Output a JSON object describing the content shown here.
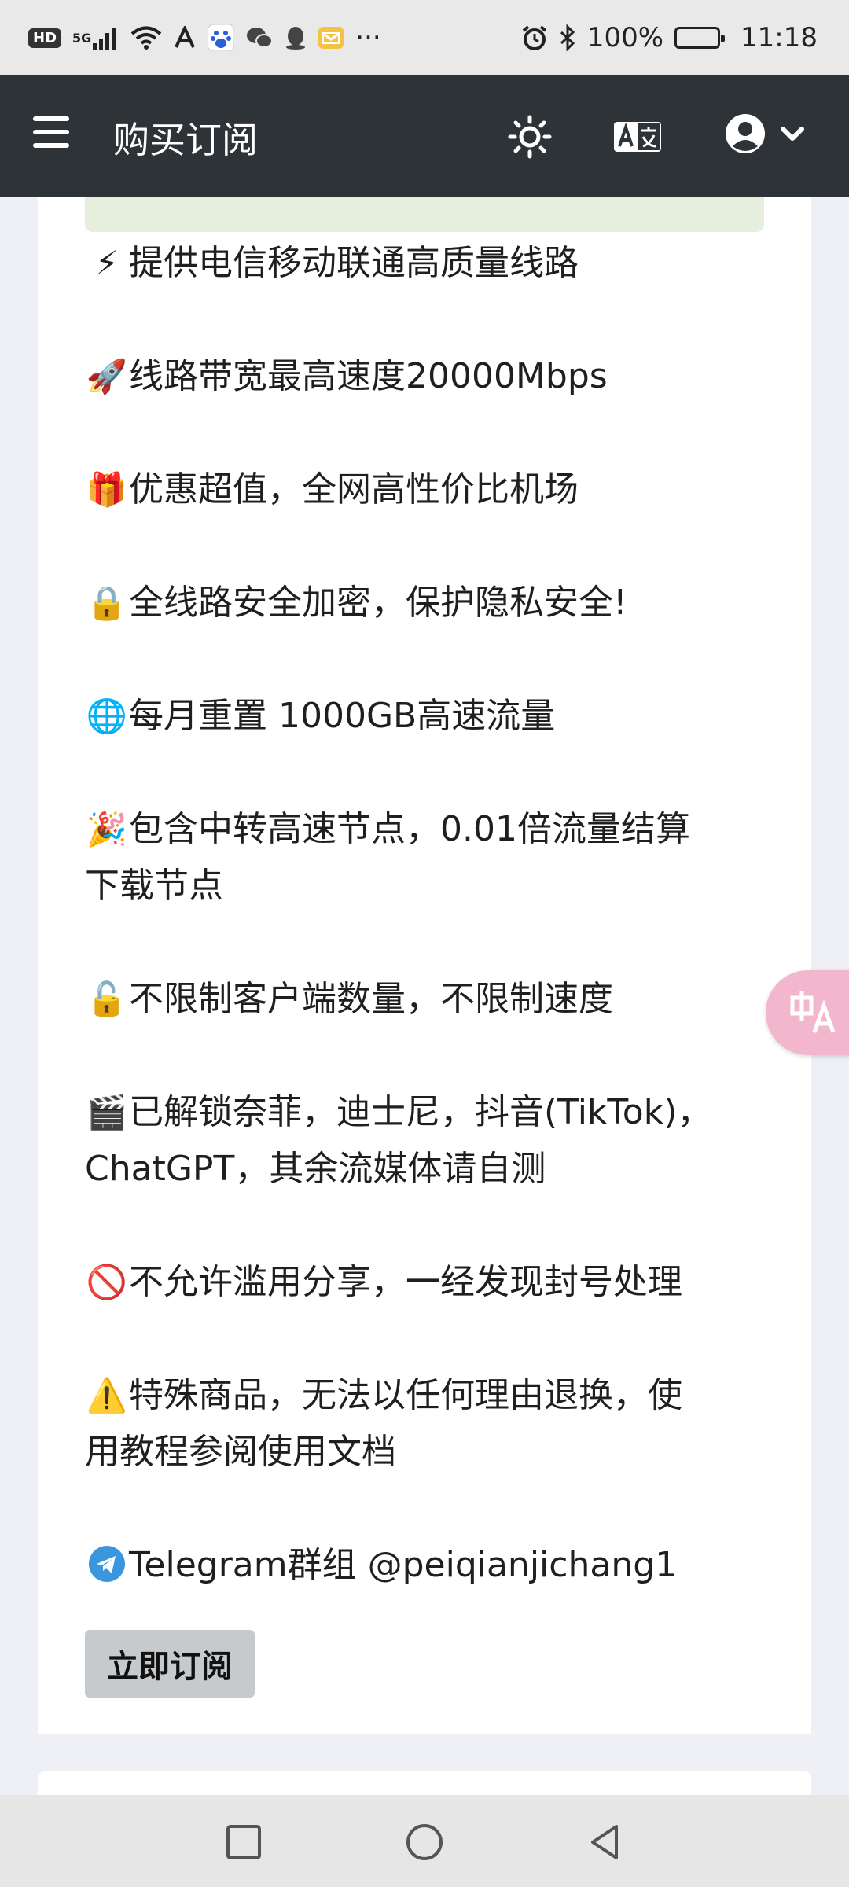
{
  "status_bar": {
    "left_icons": [
      "hd-icon",
      "5g-signal-icon",
      "wifi-icon",
      "app-icon-a",
      "baidu-icon",
      "wechat-icon",
      "qq-icon",
      "mail-icon",
      "more-icon"
    ],
    "hd_label": "HD",
    "net_label": "5G",
    "more": "···",
    "battery": "100%",
    "time": "11:18"
  },
  "navbar": {
    "title": "购买订阅",
    "icons": [
      "menu-icon",
      "theme-sun-icon",
      "translate-icon",
      "user-avatar-icon",
      "chevron-down-icon"
    ]
  },
  "features": [
    {
      "emoji": "⚡",
      "text": "提供电信移动联通高质量线路"
    },
    {
      "emoji": "🚀",
      "text": "线路带宽最高速度20000Mbps"
    },
    {
      "emoji": "🎁",
      "text": "优惠超值，全网高性价比机场"
    },
    {
      "emoji": "🔒",
      "text": "全线路安全加密，保护隐私安全!"
    },
    {
      "emoji": "🌐",
      "text": "每月重置 1000GB高速流量"
    },
    {
      "emoji": "🎉",
      "text": "包含中转高速节点，0.01倍流量结算",
      "continuation": "下载节点"
    },
    {
      "emoji": "🔓",
      "text": "不限制客户端数量，不限制速度"
    },
    {
      "emoji": "🎬",
      "text": "已解锁奈菲，迪士尼，抖音(TikTok)，",
      "continuation": "ChatGPT，其余流媒体请自测"
    },
    {
      "emoji": "🚫",
      "text": "不允许滥用分享，一经发现封号处理"
    },
    {
      "emoji": "⚠️",
      "text": "特殊商品，无法以任何理由退换，使",
      "continuation": "用教程参阅使用文档"
    },
    {
      "emoji": "✈",
      "text": "Telegram群组 @peiqianjichang1"
    }
  ],
  "subscribe_button": "立即订阅",
  "colors": {
    "navbar": "#2e3338",
    "page_bg": "#eef0f6",
    "button_bg": "#c7cacd",
    "notice_bg": "#e6efde",
    "fab": "#f2b7cc"
  }
}
